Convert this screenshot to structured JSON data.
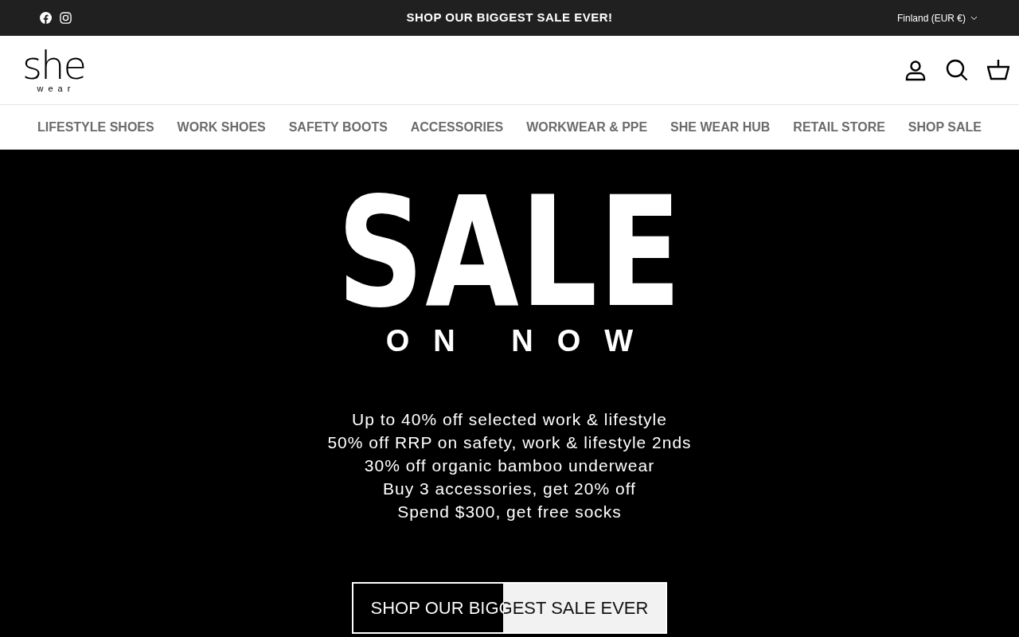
{
  "announcement_bar": {
    "message": "SHOP OUR BIGGEST SALE EVER!",
    "country_selector": "Finland (EUR €)"
  },
  "header": {
    "logo": {
      "main": "she",
      "sub": "wear"
    }
  },
  "nav": {
    "items": [
      {
        "label": "LIFESTYLE SHOES"
      },
      {
        "label": "WORK SHOES"
      },
      {
        "label": "SAFETY BOOTS"
      },
      {
        "label": "ACCESSORIES"
      },
      {
        "label": "WORKWEAR & PPE"
      },
      {
        "label": "SHE WEAR HUB"
      },
      {
        "label": "RETAIL STORE"
      },
      {
        "label": "SHOP SALE"
      }
    ]
  },
  "hero": {
    "headline": "SALE",
    "subheadline": "ON NOW",
    "offers": [
      "Up to 40% off selected work & lifestyle",
      "50% off RRP on safety, work & lifestyle 2nds",
      "30% off organic bamboo underwear",
      "Buy 3 accessories, get 20% off",
      "Spend $300, get free socks"
    ],
    "button": "SHOP OUR BIGGEST SALE EVER"
  }
}
